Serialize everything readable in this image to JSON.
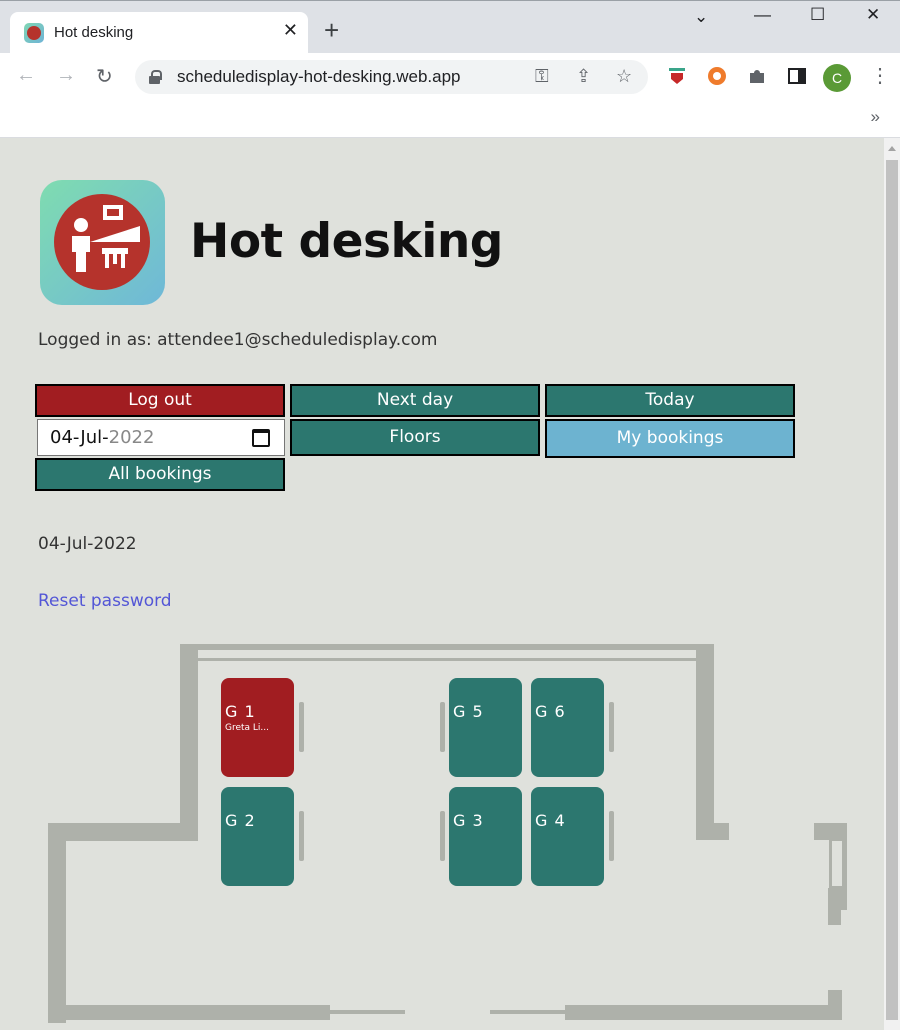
{
  "browser": {
    "tab_title": "Hot desking",
    "url": "scheduledisplay-hot-desking.web.app",
    "profile_initial": "C",
    "bookmarks_overflow": "»"
  },
  "app": {
    "title": "Hot desking",
    "logged_in_text": "Logged in as: attendee1@scheduledisplay.com",
    "buttons": {
      "logout": "Log out",
      "next_day": "Next day",
      "today": "Today",
      "floors": "Floors",
      "my_bookings": "My bookings",
      "all_bookings": "All bookings"
    },
    "date_input": {
      "day": "04",
      "month": "Jul",
      "year": "2022"
    },
    "selected_date": "04-Jul-2022",
    "reset_password": "Reset password",
    "desks": [
      {
        "id": "G 1",
        "booked_by": "Greta Li...",
        "status": "booked"
      },
      {
        "id": "G 2",
        "booked_by": "",
        "status": "free"
      },
      {
        "id": "G 3",
        "booked_by": "",
        "status": "free"
      },
      {
        "id": "G 4",
        "booked_by": "",
        "status": "free"
      },
      {
        "id": "G 5",
        "booked_by": "",
        "status": "free"
      },
      {
        "id": "G 6",
        "booked_by": "",
        "status": "free"
      }
    ]
  },
  "colors": {
    "booked": "#a11d21",
    "free": "#2c776f",
    "highlight": "#6db3d0",
    "wall": "#aeb1aa"
  }
}
